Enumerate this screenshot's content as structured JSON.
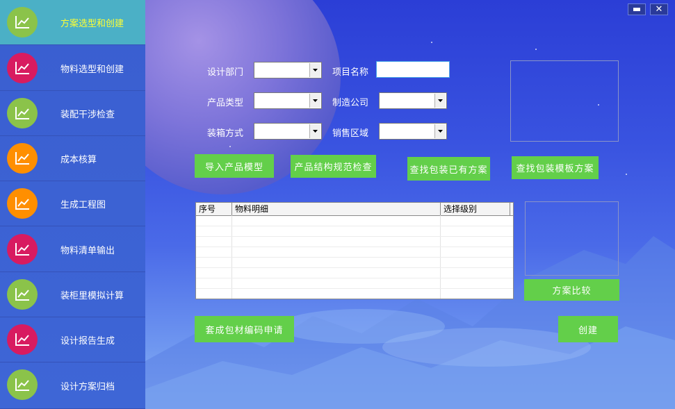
{
  "sidebar": {
    "items": [
      {
        "label": "方案选型和创建",
        "color": "#8bc34a",
        "active": true
      },
      {
        "label": "物料选型和创建",
        "color": "#d81b60",
        "active": false
      },
      {
        "label": "装配干涉检查",
        "color": "#8bc34a",
        "active": false
      },
      {
        "label": "成本核算",
        "color": "#ff8f00",
        "active": false
      },
      {
        "label": "生成工程图",
        "color": "#ff8f00",
        "active": false
      },
      {
        "label": "物料清单输出",
        "color": "#d81b60",
        "active": false
      },
      {
        "label": "装柜里模拟计算",
        "color": "#8bc34a",
        "active": false
      },
      {
        "label": "设计报告生成",
        "color": "#d81b60",
        "active": false
      },
      {
        "label": "设计方案归档",
        "color": "#8bc34a",
        "active": false
      }
    ],
    "icon": "chart-line-icon"
  },
  "window": {
    "minimize": "▬",
    "close": "✕"
  },
  "form": {
    "design_dept": "设计部门",
    "project_name": "项目名称",
    "product_type": "产品类型",
    "manufacturer": "制造公司",
    "packing_method": "装箱方式",
    "sales_region": "销售区域",
    "project_name_value": ""
  },
  "buttons": {
    "import_model": "导入产品模型",
    "structure_check": "产品结构规范检查",
    "find_existing": "查找包装已有方案",
    "find_template": "查找包装模板方案",
    "compare": "方案比较",
    "apply_code": "套成包材编码申请",
    "create": "创建"
  },
  "table": {
    "columns": [
      "序号",
      "物料明细",
      "选择级别"
    ]
  },
  "colors": {
    "button": "#63cf4a",
    "active_nav": "#4bb0c6",
    "active_label": "#ffff33"
  }
}
